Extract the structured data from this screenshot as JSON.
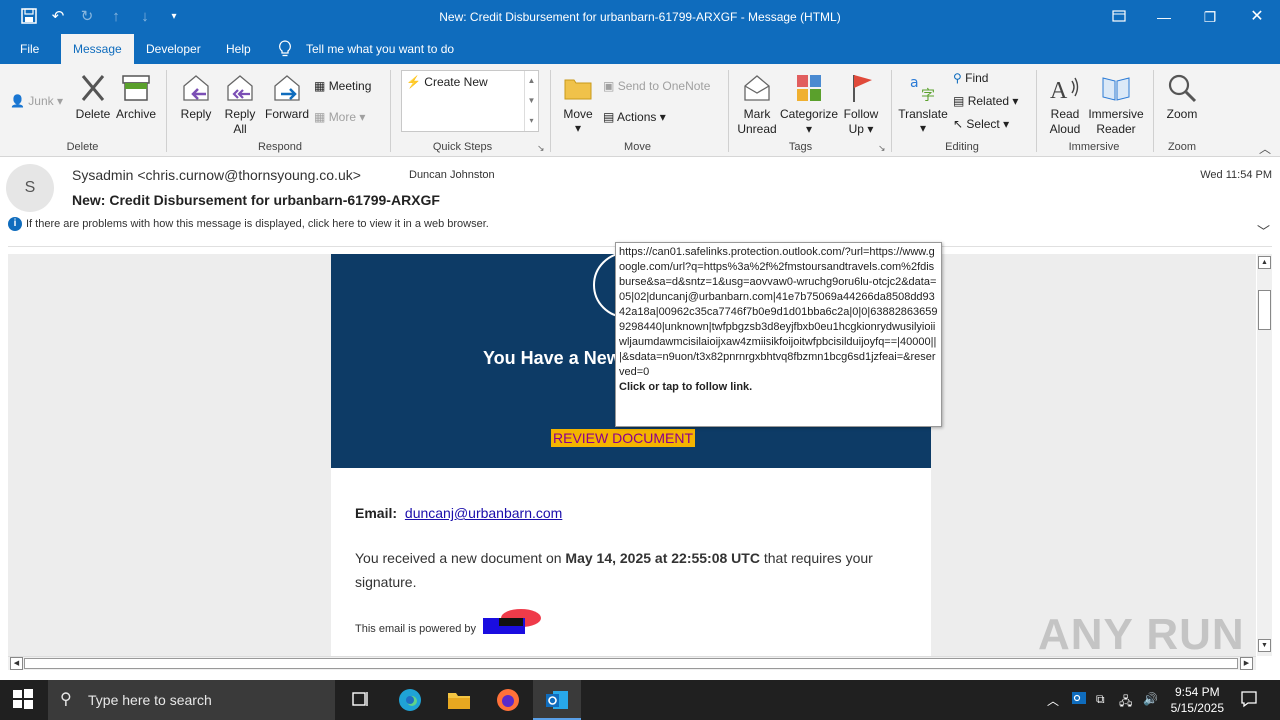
{
  "window": {
    "title": "New: Credit Disbursement for urbanbarn-61799-ARXGF  -  Message (HTML)"
  },
  "menu_tabs": [
    {
      "label": "File"
    },
    {
      "label": "Message"
    },
    {
      "label": "Developer"
    },
    {
      "label": "Help"
    }
  ],
  "tell_me": "Tell me what you want to do",
  "ribbon": {
    "delete_group": {
      "junk": "Junk",
      "delete": "Delete",
      "archive": "Archive",
      "label": "Delete"
    },
    "respond_group": {
      "reply": "Reply",
      "reply_all": "Reply All",
      "forward": "Forward",
      "meeting": "Meeting",
      "more": "More",
      "label": "Respond"
    },
    "quick_steps": {
      "create_new": "Create New",
      "label": "Quick Steps"
    },
    "move_group": {
      "move": "Move",
      "onenote": "Send to OneNote",
      "actions": "Actions",
      "label": "Move"
    },
    "tags_group": {
      "mark_unread": "Mark Unread",
      "categorize": "Categorize",
      "follow_up": "Follow Up",
      "label": "Tags"
    },
    "editing_group": {
      "translate": "Translate",
      "find": "Find",
      "related": "Related",
      "select": "Select",
      "label": "Editing"
    },
    "immersive_group": {
      "read_aloud": "Read Aloud",
      "immersive_reader": "Immersive Reader",
      "label": "Immersive"
    },
    "zoom_group": {
      "zoom": "Zoom",
      "label": "Zoom"
    }
  },
  "message": {
    "avatar_initial": "S",
    "from": "Sysadmin <chris.curnow@thornsyoung.co.uk>",
    "to": "Duncan Johnston",
    "date": "Wed 11:54 PM",
    "subject": "New: Credit Disbursement for urbanbarn-61799-ARXGF",
    "info_bar": "If there are problems with how this message is displayed, click here to view it in a web browser."
  },
  "email_body": {
    "banner_title": "You Have a New",
    "review_button": "REVIEW DOCUMENT",
    "email_label": "Email:",
    "email_value": "duncanj@urbanbarn.com",
    "received_prefix": "You received a new document on",
    "received_date": "May 14, 2025 at 22:55:08 UTC",
    "received_suffix": "that requires your signature.",
    "powered_by": "This email is powered by"
  },
  "tooltip": {
    "url": "https://can01.safelinks.protection.outlook.com/?url=https://www.google.com/url?q=https%3a%2f%2fmstoursandtravels.com%2fdisburse&sa=d&sntz=1&usg=aovvaw0-wruchg9oru6lu-otcjc2&data=05|02|duncanj@urbanbarn.com|41e7b75069a44266da8508dd9342a18a|00962c35ca7746f7b0e9d1d01bba6c2a|0|0|638828636599298440|unknown|twfpbgzsb3d8eyjfbxb0eu1hcgkionrydwusilyioiiwljaumdawmcisilaioijxaw4zmiisikfoijoitwfpbcisilduijoyfq==|40000|||&sdata=n9uon/t3x82pnrnrgxbhtvq8fbzmn1bcg6sd1jzfeai=&reserved=0",
    "hint": "Click or tap to follow link."
  },
  "watermark": "ANY RUN",
  "taskbar": {
    "search_placeholder": "Type here to search",
    "time": "9:54 PM",
    "date": "5/15/2025"
  },
  "colors": {
    "titlebar": "#0f6cbd",
    "banner": "#0d3b66",
    "review_bg": "#f4b400",
    "review_text": "#8b008b"
  }
}
